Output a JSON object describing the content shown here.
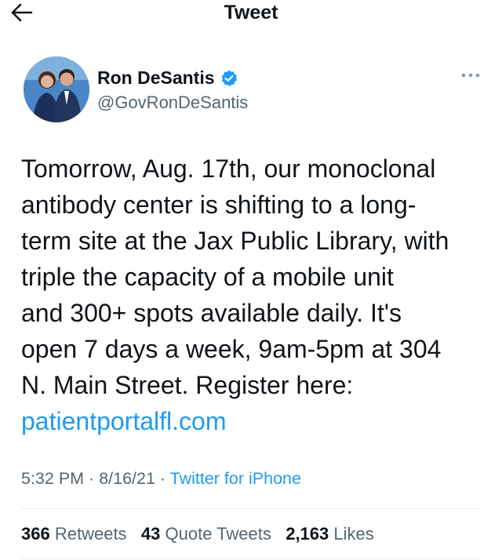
{
  "header": {
    "title": "Tweet",
    "back_icon": "arrow-left-icon"
  },
  "author": {
    "name": "Ron DeSantis",
    "handle": "@GovRonDeSantis",
    "verified_icon": "verified-badge-icon",
    "avatar_icon": "avatar"
  },
  "more_icon": "more-horizontal-icon",
  "tweet": {
    "text": "Tomorrow, Aug. 17th, our monoclonal\nantibody center is shifting to a long-\nterm site at the Jax Public Library, with\ntriple the capacity of a mobile unit\nand 300+ spots available daily. It's\nopen 7 days a week, 9am-5pm at 304\nN. Main Street. Register here:",
    "link": "patientportalfl.com"
  },
  "meta": {
    "time": "5:32 PM",
    "sep1": " · ",
    "date": "8/16/21",
    "sep2": " · ",
    "source": "Twitter for iPhone"
  },
  "stats": {
    "retweets_count": "366",
    "retweets_label": "Retweets",
    "quotes_count": "43",
    "quotes_label": "Quote Tweets",
    "likes_count": "2,163",
    "likes_label": "Likes"
  },
  "colors": {
    "accent": "#1d9bf0",
    "text": "#0f1419",
    "secondary": "#536471"
  }
}
